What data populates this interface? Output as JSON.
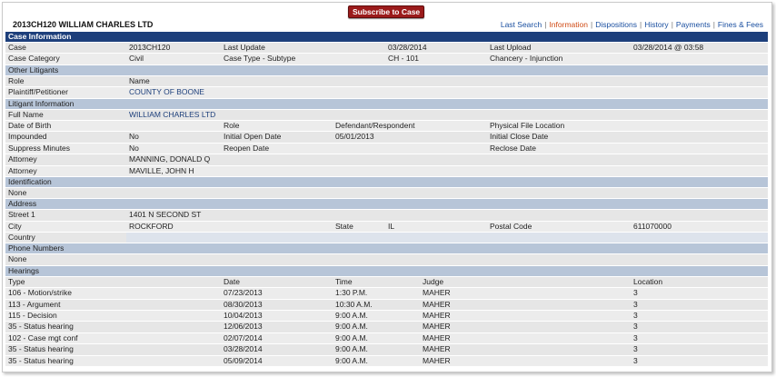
{
  "header": {
    "case_title": "2013CH120  WILLIAM CHARLES LTD",
    "subscribe_label": "Subscribe to Case",
    "nav": [
      {
        "label": "Last Search",
        "active": false
      },
      {
        "label": "Information",
        "active": true
      },
      {
        "label": "Dispositions",
        "active": false
      },
      {
        "label": "History",
        "active": false
      },
      {
        "label": "Payments",
        "active": false
      },
      {
        "label": "Fines & Fees",
        "active": false
      }
    ]
  },
  "case_information": {
    "heading": "Case Information",
    "labels": {
      "case": "Case",
      "last_update": "Last Update",
      "last_upload": "Last Upload",
      "case_category": "Case Category",
      "case_type": "Case Type - Subtype"
    },
    "case": "2013CH120",
    "last_update": "03/28/2014",
    "last_upload": "03/28/2014 @ 03:58",
    "case_category": "Civil",
    "case_type_code": "CH - 101",
    "case_type_desc": "Chancery - Injunction"
  },
  "other_litigants": {
    "heading": "Other Litigants",
    "col_role": "Role",
    "col_name": "Name",
    "rows": [
      {
        "role": "Plaintiff/Petitioner",
        "name": "COUNTY OF BOONE"
      }
    ]
  },
  "litigant_information": {
    "heading": "Litigant Information",
    "labels": {
      "full_name": "Full Name",
      "dob": "Date of Birth",
      "role": "Role",
      "physical_file": "Physical File Location",
      "impounded": "Impounded",
      "initial_open": "Initial Open Date",
      "initial_close": "Initial Close Date",
      "suppress": "Suppress Minutes",
      "reopen": "Reopen Date",
      "reclose": "Reclose Date",
      "attorney": "Attorney"
    },
    "full_name": "WILLIAM CHARLES LTD",
    "dob": "",
    "role": "Defendant/Respondent",
    "physical_file": "",
    "impounded": "No",
    "initial_open": "05/01/2013",
    "initial_close": "",
    "suppress": "No",
    "reopen": "",
    "reclose": "",
    "attorneys": [
      "MANNING, DONALD Q",
      "MAVILLE, JOHN H"
    ]
  },
  "identification": {
    "heading": "Identification",
    "value": "None"
  },
  "address": {
    "heading": "Address",
    "labels": {
      "street1": "Street 1",
      "city": "City",
      "state": "State",
      "postal": "Postal Code",
      "country": "Country"
    },
    "street1": "1401 N SECOND ST",
    "city": "ROCKFORD",
    "state": "IL",
    "postal": "611070000",
    "country": ""
  },
  "phone_numbers": {
    "heading": "Phone Numbers",
    "value": "None"
  },
  "hearings": {
    "heading": "Hearings",
    "columns": [
      "Type",
      "Date",
      "Time",
      "Judge",
      "Location"
    ],
    "rows": [
      [
        "106 - Motion/strike",
        "07/23/2013",
        "1:30 P.M.",
        "MAHER",
        "3"
      ],
      [
        "113 - Argument",
        "08/30/2013",
        "10:30 A.M.",
        "MAHER",
        "3"
      ],
      [
        "115 - Decision",
        "10/04/2013",
        "9:00 A.M.",
        "MAHER",
        "3"
      ],
      [
        "35 - Status hearing",
        "12/06/2013",
        "9:00 A.M.",
        "MAHER",
        "3"
      ],
      [
        "102 - Case mgt conf",
        "02/07/2014",
        "9:00 A.M.",
        "MAHER",
        "3"
      ],
      [
        "35 - Status hearing",
        "03/28/2014",
        "9:00 A.M.",
        "MAHER",
        "3"
      ],
      [
        "35 - Status hearing",
        "05/09/2014",
        "9:00 A.M.",
        "MAHER",
        "3"
      ]
    ]
  },
  "colors": {
    "header_navy": "#1d3f7b",
    "section_blue": "#b7c5d8",
    "subscribe_red": "#9b1b1b",
    "nav_link": "#1a4fa0",
    "nav_active": "#d04b15"
  }
}
